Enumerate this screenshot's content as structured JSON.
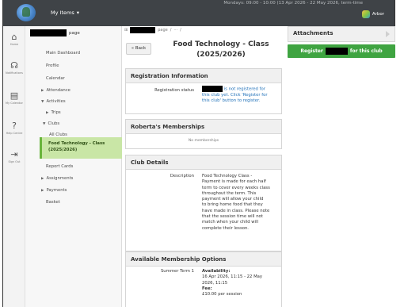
{
  "topbar": {
    "schedule": "Mondays: 09:00 - 10:00 (13 Apr 2026 - 22 May 2026, term-time",
    "my_items": "My Items",
    "brand": "Arbor",
    "logo_icon": "school-crest-icon"
  },
  "rail": [
    {
      "name": "home",
      "glyph": "⌂",
      "label": "Home"
    },
    {
      "name": "notifications",
      "glyph": "☊",
      "label": "Notifications"
    },
    {
      "name": "calendar",
      "glyph": "▤",
      "label": "My Calendar"
    },
    {
      "name": "help",
      "glyph": "?",
      "label": "Help Centre"
    },
    {
      "name": "signout",
      "glyph": "⇥",
      "label": "Sign Out"
    }
  ],
  "sidenav": {
    "header_suffix": "page",
    "items": {
      "dashboard": "Main Dashboard",
      "profile": "Profile",
      "calendar": "Calendar",
      "attendance": "Attendance",
      "activities": "Activities",
      "trips": "Trips",
      "clubs": "Clubs",
      "all_clubs": "All Clubs",
      "active_line1": "Food Technology - Class",
      "active_line2": "(2025/2026)",
      "report_cards": "Report Cards",
      "assignments": "Assignments",
      "payments": "Payments",
      "basket": "Basket"
    }
  },
  "breadcrumb": {
    "icon": "app-grid-icon",
    "suffix": "page",
    "sep": "/",
    "ellipsis": "···"
  },
  "main": {
    "back_label": "« Back",
    "title_line1": "Food Technology - Class",
    "title_line2": "(2025/2026)",
    "registration": {
      "heading": "Registration Information",
      "status_label": "Registration status",
      "status_text_1": "is not registered for",
      "status_text_2": "this club yet. Click 'Register for",
      "status_text_3": "this club' button to register."
    },
    "memberships": {
      "heading": "Roberta's Memberships",
      "empty": "No memberships"
    },
    "details": {
      "heading": "Club Details",
      "desc_label": "Description",
      "desc_lines": [
        "Food Technology Class -",
        "Payment is made for each half",
        "term to cover every weeks class",
        "throughout the term. This",
        "payment will allow your child",
        "to bring home food that they",
        "have made in class. Please note",
        "that the session time will not",
        "match when your child will",
        "complete their lesson."
      ]
    },
    "options": {
      "heading": "Available Membership Options",
      "term_label": "Summer Term 1",
      "availability_label": "Availability:",
      "availability_1": "16 Apr 2026, 11:15 - 22 May",
      "availability_2": "2026, 11:15",
      "fee_label": "Fee:",
      "fee_value": "£10.00 per session"
    }
  },
  "right": {
    "attachments": "Attachments",
    "register_prefix": "Register",
    "register_suffix": "for this club"
  }
}
